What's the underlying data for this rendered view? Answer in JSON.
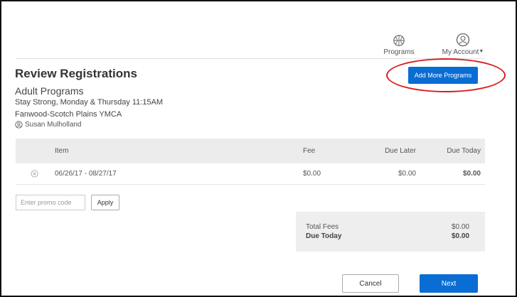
{
  "nav": {
    "programs_label": "Programs",
    "programs_icon": "basketball-icon",
    "account_label": "My Account",
    "account_icon": "user-icon"
  },
  "header": {
    "title": "Review Registrations",
    "add_more_label": "Add More Programs",
    "accent_color": "#0a6dd4",
    "highlight_color": "#d81c1c"
  },
  "registration": {
    "program": "Adult Programs",
    "session": "Stay Strong, Monday & Thursday 11:15AM",
    "location": "Fanwood-Scotch Plains YMCA",
    "participant": "Susan Mulholland"
  },
  "table": {
    "columns": [
      "Item",
      "Fee",
      "Due Later",
      "Due Today"
    ],
    "rows": [
      {
        "item": "06/26/17 - 08/27/17",
        "fee": "$0.00",
        "due_later": "$0.00",
        "due_today": "$0.00"
      }
    ]
  },
  "promo": {
    "placeholder": "Enter promo code",
    "apply_label": "Apply"
  },
  "totals": {
    "total_fees_label": "Total Fees",
    "total_fees_value": "$0.00",
    "due_today_label": "Due Today",
    "due_today_value": "$0.00"
  },
  "footer": {
    "cancel_label": "Cancel",
    "next_label": "Next"
  }
}
